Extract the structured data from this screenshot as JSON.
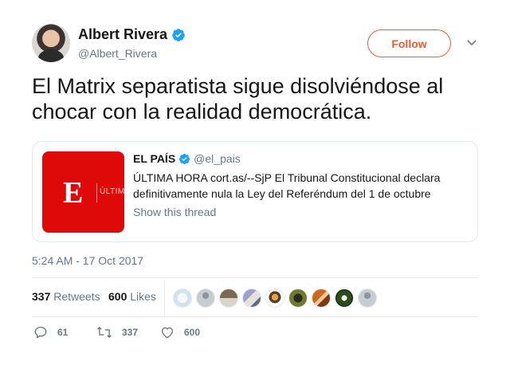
{
  "author": {
    "display_name": "Albert Rivera",
    "handle": "@Albert_Rivera",
    "verified_icon": "verified-badge-icon",
    "follow_label": "Follow"
  },
  "tweet": {
    "text": "El Matrix separatista sigue disolviéndose al chocar con la realidad democrática."
  },
  "quote": {
    "name": "EL PAÍS",
    "handle": "@el_pais",
    "text": "ÚLTIMA HORA  cort.as/--SjP El Tribunal Constitucional declara definitivamente nula la Ley del Referéndum del 1 de octubre",
    "show_thread": "Show this thread",
    "image_logo_letter": "E",
    "image_logo_text": "ÚLTIM"
  },
  "timestamp": "5:24 AM - 17 Oct 2017",
  "stats": {
    "retweets_count": "337",
    "retweets_label": "Retweets",
    "likes_count": "600",
    "likes_label": "Likes"
  },
  "actions": {
    "replies": "61",
    "retweets": "337",
    "likes": "600"
  },
  "colors": {
    "accent": "#ee5a2e",
    "verified": "#1da1f2",
    "muted": "#657786"
  }
}
